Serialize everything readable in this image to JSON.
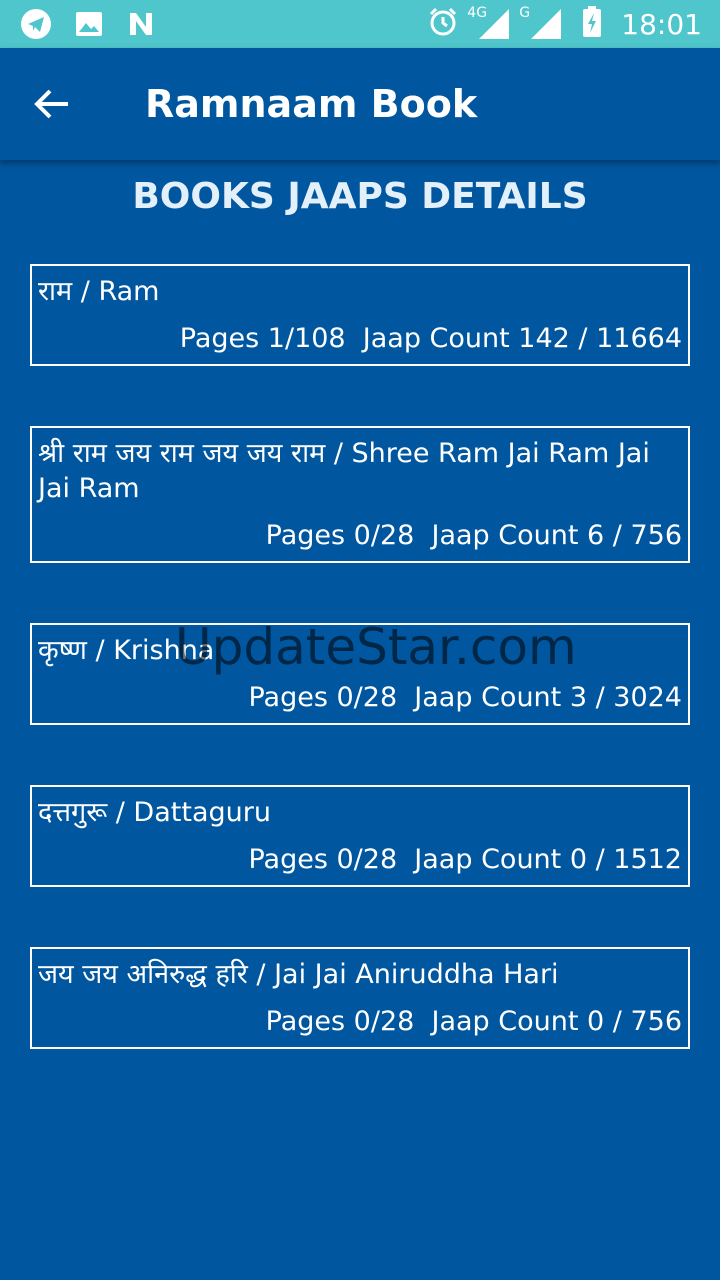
{
  "status_bar": {
    "time": "18:01",
    "network1": "4G",
    "network2": "G",
    "left_icons": [
      "telegram-icon",
      "image-icon",
      "n-icon"
    ],
    "right_icons": [
      "alarm-icon",
      "signal-icon",
      "signal-icon",
      "battery-charging-icon"
    ]
  },
  "app_bar": {
    "title": "Ramnaam Book",
    "back_icon": "arrow-left-icon"
  },
  "section_title": "BOOKS JAAPS DETAILS",
  "books": [
    {
      "name": "राम / Ram",
      "stats": "Pages 1/108  Jaap Count 142 / 11664"
    },
    {
      "name": "श्री राम जय राम जय जय राम / Shree Ram Jai Ram Jai Jai Ram",
      "stats": "Pages 0/28  Jaap Count 6 / 756"
    },
    {
      "name": "कृष्ण / Krishna",
      "stats": "Pages 0/28  Jaap Count 3 / 3024"
    },
    {
      "name": "दत्तगुरू / Dattaguru",
      "stats": "Pages 0/28  Jaap Count 0 / 1512"
    },
    {
      "name": "जय जय अनिरुद्ध हरि / Jai Jai Aniruddha Hari",
      "stats": "Pages 0/28  Jaap Count 0 / 756"
    }
  ],
  "watermark": "UpdateStar.com",
  "colors": {
    "status_bar": "#4FC6CB",
    "background": "#00569F",
    "text": "#FFFFFF"
  }
}
